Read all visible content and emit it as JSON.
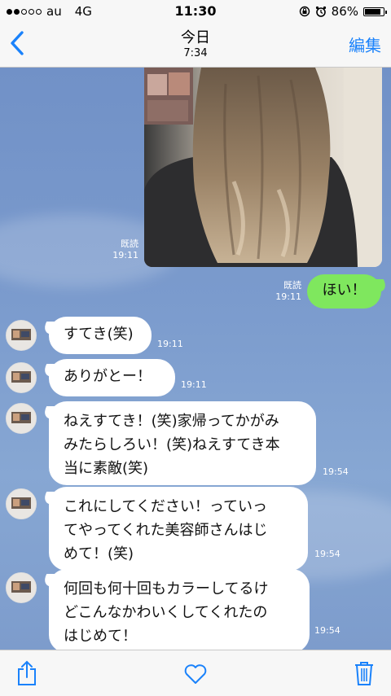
{
  "status_bar": {
    "carrier": "au",
    "network": "4G",
    "time": "11:30",
    "battery_percent": "86%",
    "battery_level": 0.86
  },
  "nav": {
    "title": "今日",
    "subtitle": "7:34",
    "edit_label": "編集",
    "accent_color": "#1a82fb"
  },
  "messages": {
    "photo": {
      "read": "既読",
      "time": "19:11"
    },
    "sent": {
      "text": "ほい！",
      "read": "既読",
      "time": "19:11"
    },
    "received": [
      {
        "text": "すてき(笑)",
        "time": "19:11"
      },
      {
        "text": "ありがとー！",
        "time": "19:11"
      },
      {
        "lines": [
          "ねえすてき！(笑)家帰ってかがみ",
          "みたらしろい！(笑)ねえすてき本",
          "当に素敵(笑)"
        ],
        "time": "19:54"
      },
      {
        "lines": [
          "これにしてください！っていっ",
          "てやってくれた美容師さんはじ",
          "めて！(笑)"
        ],
        "time": "19:54"
      },
      {
        "lines": [
          "何回も何十回もカラーしてるけ",
          "どこんなかわいくしてくれたの",
          "はじめて！"
        ],
        "time": "19:54"
      }
    ]
  },
  "toolbar": {
    "share_icon": "share-icon",
    "like_icon": "heart-icon",
    "delete_icon": "trash-icon"
  },
  "colors": {
    "chat_background": "#7b9bcd",
    "sent_bubble": "#7fe75e",
    "received_bubble": "#ffffff"
  }
}
